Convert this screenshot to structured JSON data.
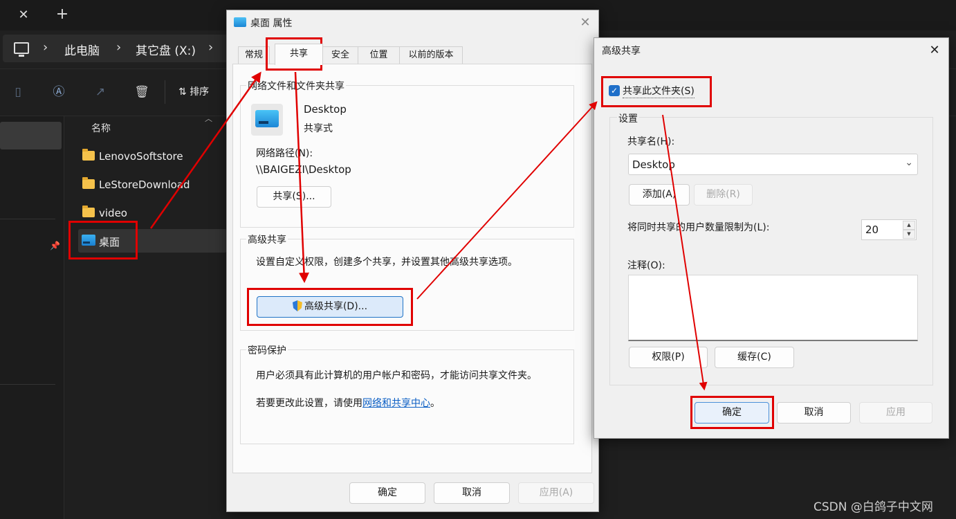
{
  "explorer": {
    "close_glyph": "✕",
    "new_tab_glyph": "+",
    "breadcrumb": [
      "此电脑",
      "其它盘 (X:)"
    ],
    "breadcrumb_sep": "›",
    "toolbar": {
      "sort_label": "排序",
      "sort_glyph": "⇅"
    },
    "column_name": "名称",
    "files": [
      "LenovoSoftstore",
      "LeStoreDownload",
      "video",
      "桌面"
    ],
    "watermark": "CSDN @白鸽子中文网"
  },
  "properties": {
    "title": "桌面 属性",
    "close_glyph": "✕",
    "tabs": [
      "常规",
      "共享",
      "安全",
      "位置",
      "以前的版本"
    ],
    "active_tab": "共享",
    "network_sharing": {
      "group_title": "网络文件和文件夹共享",
      "folder_name": "Desktop",
      "folder_state": "共享式",
      "network_path_label": "网络路径(N):",
      "network_path": "\\\\BAIGEZI\\Desktop",
      "share_button": "共享(S)..."
    },
    "advanced_sharing": {
      "group_title": "高级共享",
      "description": "设置自定义权限，创建多个共享，并设置其他高级共享选项。",
      "button": "高级共享(D)..."
    },
    "password": {
      "group_title": "密码保护",
      "line1": "用户必须具有此计算机的用户帐户和密码，才能访问共享文件夹。",
      "line2_prefix": "若要更改此设置，请使用",
      "line2_link": "网络和共享中心",
      "line2_suffix": "。"
    },
    "buttons": {
      "ok": "确定",
      "cancel": "取消",
      "apply": "应用(A)"
    }
  },
  "advanced": {
    "title": "高级共享",
    "close_glyph": "✕",
    "share_checkbox": {
      "label": "共享此文件夹(S)",
      "checked": true,
      "glyph": "✓"
    },
    "settings": {
      "title": "设置",
      "share_name_label": "共享名(H):",
      "share_name_value": "Desktop",
      "dropdown_glyph": "⌄",
      "add_button": "添加(A)",
      "remove_button": "删除(R)",
      "user_limit_label": "将同时共享的用户数量限制为(L):",
      "user_limit_value": "20",
      "comment_label": "注释(O):",
      "permissions_button": "权限(P)",
      "caching_button": "缓存(C)"
    },
    "buttons": {
      "ok": "确定",
      "cancel": "取消",
      "apply": "应用"
    }
  },
  "colors": {
    "highlight": "#e00000",
    "accent": "#1f6fc9",
    "link": "#0a5ec4"
  }
}
